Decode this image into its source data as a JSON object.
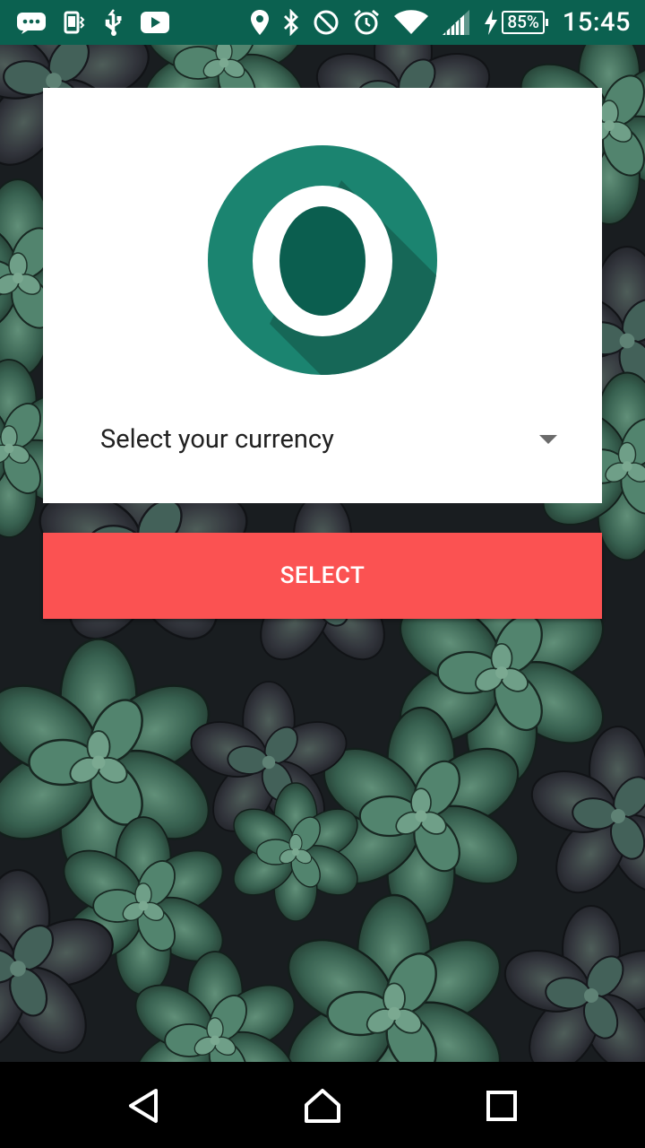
{
  "status_bar": {
    "left_icons": [
      "message-icon",
      "vibrate-icon",
      "usb-icon",
      "youtube-icon"
    ],
    "right_icons": [
      "location-icon",
      "bluetooth-icon",
      "do-not-disturb-icon",
      "alarm-icon",
      "wifi-icon",
      "signal-icon",
      "charging-icon"
    ],
    "battery_percent": "85%",
    "time": "15:45",
    "background_color": "#0b6150"
  },
  "app": {
    "logo": "app-logo-o-icon",
    "logo_color": "#0f7e69",
    "currency_spinner": {
      "label": "Select your currency",
      "icon": "dropdown-arrow-icon"
    },
    "select_button": {
      "label": "SELECT",
      "color": "#fb5252"
    },
    "background": "succulents-wallpaper"
  },
  "nav_bar": {
    "buttons": [
      "back-icon",
      "home-icon",
      "recents-icon"
    ]
  }
}
